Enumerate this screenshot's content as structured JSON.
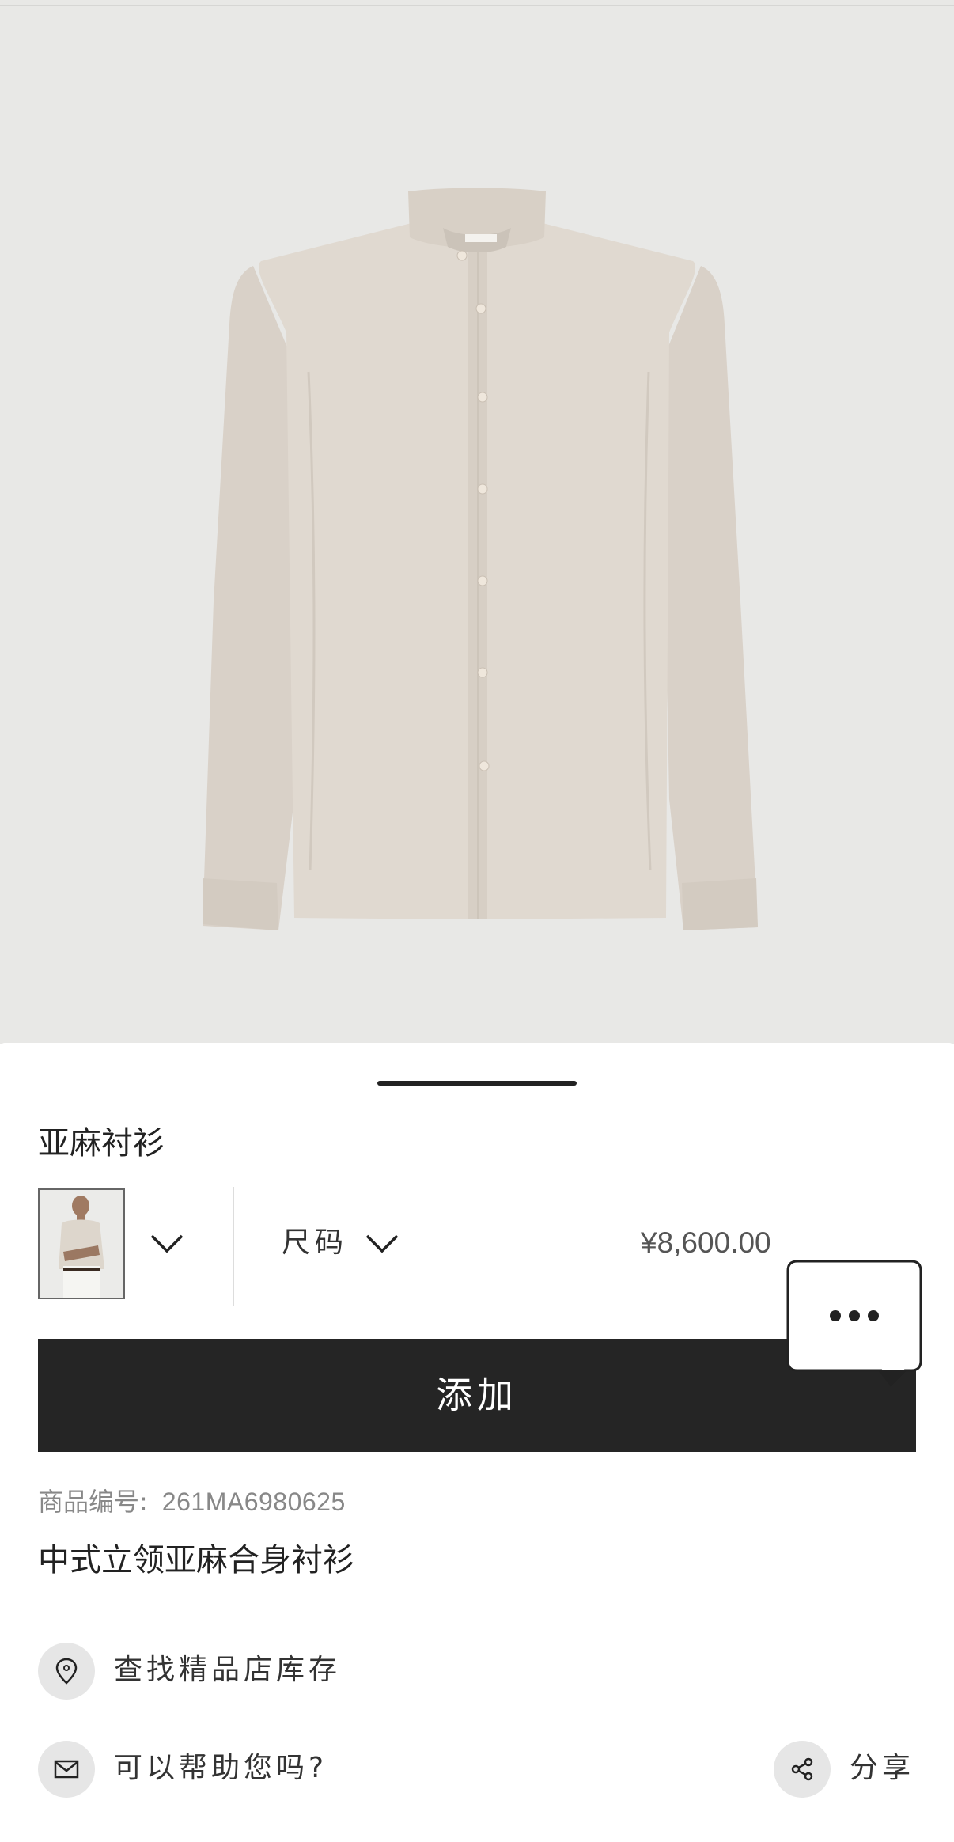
{
  "product": {
    "title": "亚麻衬衫",
    "size_label": "尺码",
    "price": "¥8,600.00",
    "add_label": "添加",
    "sku_label": "商品编号:",
    "sku_value": "261MA6980625",
    "description": "中式立领亚麻合身衬衫"
  },
  "actions": {
    "find_store": "查找精品店库存",
    "help": "可以帮助您吗?",
    "share": "分享"
  },
  "icons": {
    "variant_chevron": "chevron-down-icon",
    "size_chevron": "chevron-down-icon",
    "chat": "chat-bubble-icon",
    "location": "location-pin-icon",
    "mail": "mail-icon",
    "share": "share-icon"
  },
  "colors": {
    "hero_bg": "#e8e8e6",
    "button_bg": "#252525",
    "shirt": "#ddd5cc"
  }
}
